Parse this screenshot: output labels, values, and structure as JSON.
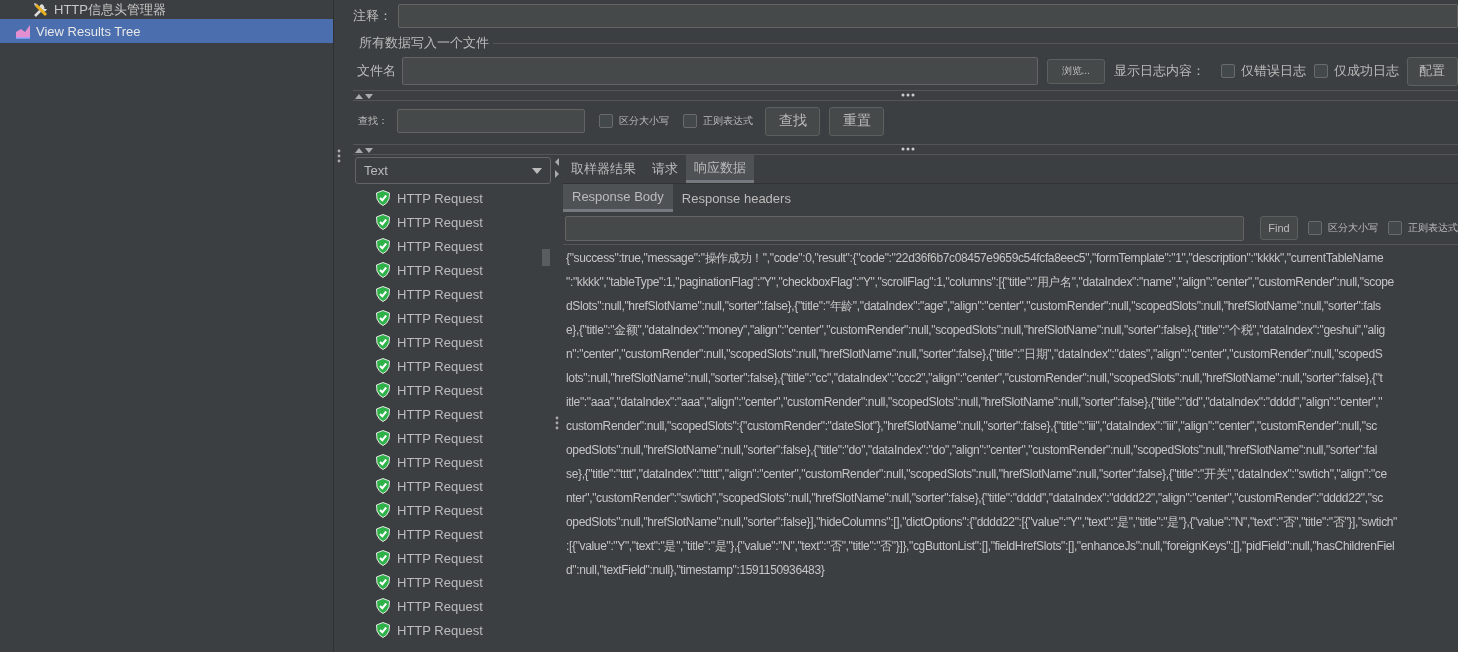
{
  "tree": {
    "items": [
      {
        "label": "HTTP信息头管理器",
        "kind": "config",
        "selected": false
      },
      {
        "label": "View Results Tree",
        "kind": "listener",
        "selected": true
      }
    ]
  },
  "comment_row": {
    "label": "注释："
  },
  "file_group": {
    "title": "所有数据写入一个文件",
    "file_label": "文件名",
    "browse_button": "浏览...",
    "log_label": "显示日志内容：",
    "options": [
      {
        "label": "仅错误日志",
        "checked": false
      },
      {
        "label": "仅成功日志",
        "checked": false
      }
    ],
    "config_button": "配置"
  },
  "search": {
    "label": "查找：",
    "options": [
      {
        "label": "区分大小写",
        "checked": false
      },
      {
        "label": "正则表达式",
        "checked": false
      }
    ],
    "buttons": [
      "查找",
      "重置"
    ]
  },
  "renderer": {
    "value": "Text"
  },
  "samples": [
    {
      "label": "HTTP Request",
      "success": true
    },
    {
      "label": "HTTP Request",
      "success": true
    },
    {
      "label": "HTTP Request",
      "success": true
    },
    {
      "label": "HTTP Request",
      "success": true
    },
    {
      "label": "HTTP Request",
      "success": true
    },
    {
      "label": "HTTP Request",
      "success": true
    },
    {
      "label": "HTTP Request",
      "success": true
    },
    {
      "label": "HTTP Request",
      "success": true
    },
    {
      "label": "HTTP Request",
      "success": true
    },
    {
      "label": "HTTP Request",
      "success": true
    },
    {
      "label": "HTTP Request",
      "success": true
    },
    {
      "label": "HTTP Request",
      "success": true
    },
    {
      "label": "HTTP Request",
      "success": true
    },
    {
      "label": "HTTP Request",
      "success": true
    },
    {
      "label": "HTTP Request",
      "success": true
    },
    {
      "label": "HTTP Request",
      "success": true
    },
    {
      "label": "HTTP Request",
      "success": true
    },
    {
      "label": "HTTP Request",
      "success": true
    },
    {
      "label": "HTTP Request",
      "success": true
    }
  ],
  "tabs": [
    {
      "label": "取样器结果",
      "selected": false
    },
    {
      "label": "请求",
      "selected": false
    },
    {
      "label": "响应数据",
      "selected": true
    }
  ],
  "subtabs": [
    {
      "label": "Response Body",
      "selected": true
    },
    {
      "label": "Response headers",
      "selected": false
    }
  ],
  "find": {
    "button": "Find",
    "options": [
      {
        "label": "区分大小写",
        "checked": false
      },
      {
        "label": "正则表达式",
        "checked": false
      }
    ]
  },
  "response_lines": [
    "{\"success\":true,\"message\":\"操作成功！\",\"code\":0,\"result\":{\"code\":\"22d36f6b7c08457e9659c54fcfa8eec5\",\"formTemplate\":\"1\",\"description\":\"kkkk\",\"currentTableName",
    "\":\"kkkk\",\"tableType\":1,\"paginationFlag\":\"Y\",\"checkboxFlag\":\"Y\",\"scrollFlag\":1,\"columns\":[{\"title\":\"用户名\",\"dataIndex\":\"name\",\"align\":\"center\",\"customRender\":null,\"scope",
    "dSlots\":null,\"hrefSlotName\":null,\"sorter\":false},{\"title\":\"年龄\",\"dataIndex\":\"age\",\"align\":\"center\",\"customRender\":null,\"scopedSlots\":null,\"hrefSlotName\":null,\"sorter\":fals",
    "e},{\"title\":\"金额\",\"dataIndex\":\"money\",\"align\":\"center\",\"customRender\":null,\"scopedSlots\":null,\"hrefSlotName\":null,\"sorter\":false},{\"title\":\"个税\",\"dataIndex\":\"geshui\",\"alig",
    "n\":\"center\",\"customRender\":null,\"scopedSlots\":null,\"hrefSlotName\":null,\"sorter\":false},{\"title\":\"日期\",\"dataIndex\":\"dates\",\"align\":\"center\",\"customRender\":null,\"scopedS",
    "lots\":null,\"hrefSlotName\":null,\"sorter\":false},{\"title\":\"cc\",\"dataIndex\":\"ccc2\",\"align\":\"center\",\"customRender\":null,\"scopedSlots\":null,\"hrefSlotName\":null,\"sorter\":false},{\"t",
    "itle\":\"aaa\",\"dataIndex\":\"aaa\",\"align\":\"center\",\"customRender\":null,\"scopedSlots\":null,\"hrefSlotName\":null,\"sorter\":false},{\"title\":\"dd\",\"dataIndex\":\"dddd\",\"align\":\"center\",\"",
    "customRender\":null,\"scopedSlots\":{\"customRender\":\"dateSlot\"},\"hrefSlotName\":null,\"sorter\":false},{\"title\":\"iii\",\"dataIndex\":\"iii\",\"align\":\"center\",\"customRender\":null,\"sc",
    "opedSlots\":null,\"hrefSlotName\":null,\"sorter\":false},{\"title\":\"do\",\"dataIndex\":\"do\",\"align\":\"center\",\"customRender\":null,\"scopedSlots\":null,\"hrefSlotName\":null,\"sorter\":fal",
    "se},{\"title\":\"tttt\",\"dataIndex\":\"ttttt\",\"align\":\"center\",\"customRender\":null,\"scopedSlots\":null,\"hrefSlotName\":null,\"sorter\":false},{\"title\":\"开关\",\"dataIndex\":\"swtich\",\"align\":\"ce",
    "nter\",\"customRender\":\"swtich\",\"scopedSlots\":null,\"hrefSlotName\":null,\"sorter\":false},{\"title\":\"dddd\",\"dataIndex\":\"dddd22\",\"align\":\"center\",\"customRender\":\"dddd22\",\"sc",
    "opedSlots\":null,\"hrefSlotName\":null,\"sorter\":false}],\"hideColumns\":[],\"dictOptions\":{\"dddd22\":[{\"value\":\"Y\",\"text\":\"是\",\"title\":\"是\"},{\"value\":\"N\",\"text\":\"否\",\"title\":\"否\"}],\"swtich\"",
    ":[{\"value\":\"Y\",\"text\":\"是\",\"title\":\"是\"},{\"value\":\"N\",\"text\":\"否\",\"title\":\"否\"}]},\"cgButtonList\":[],\"fieldHrefSlots\":[],\"enhanceJs\":null,\"foreignKeys\":[],\"pidField\":null,\"hasChildrenFiel",
    "d\":null,\"textField\":null},\"timestamp\":1591150936483}"
  ]
}
